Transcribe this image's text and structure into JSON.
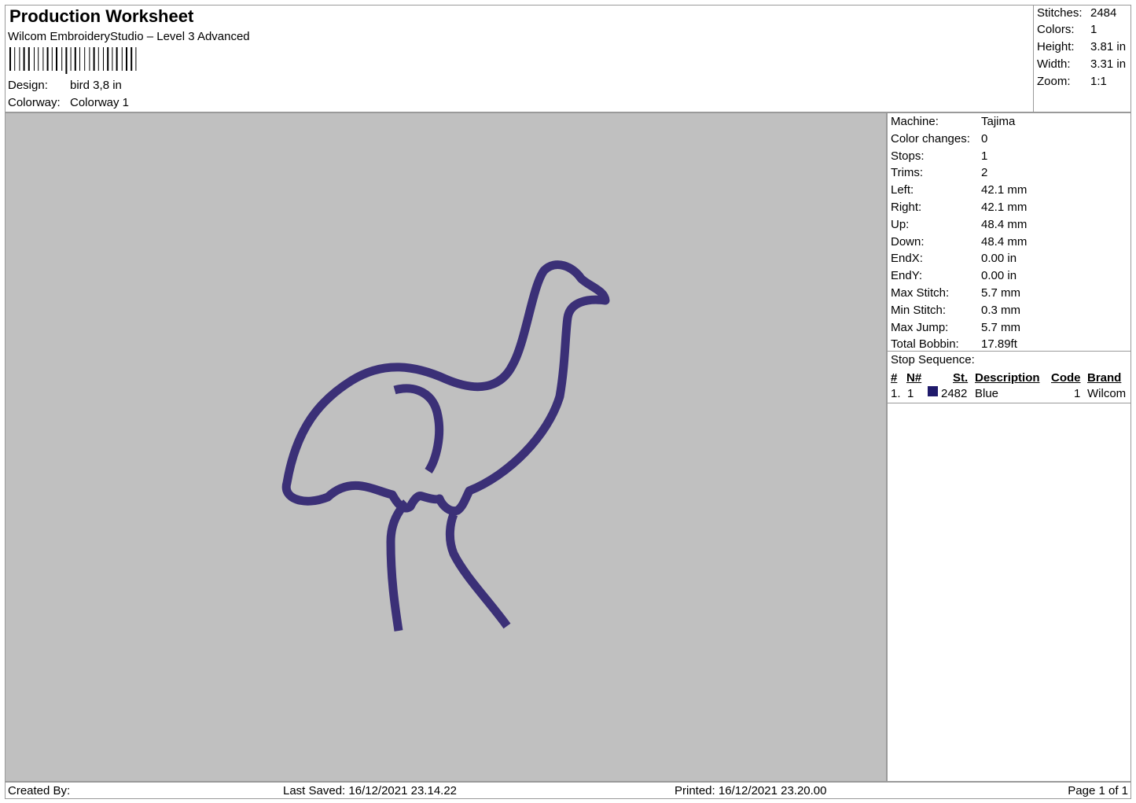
{
  "header": {
    "title": "Production Worksheet",
    "subtitle": "Wilcom EmbroideryStudio – Level 3 Advanced",
    "design_label": "Design:",
    "design_value": "bird 3,8 in",
    "colorway_label": "Colorway:",
    "colorway_value": "Colorway 1"
  },
  "stats": [
    {
      "label": "Stitches:",
      "value": "2484"
    },
    {
      "label": "Colors:",
      "value": "1"
    },
    {
      "label": "Height:",
      "value": "3.81 in"
    },
    {
      "label": "Width:",
      "value": "3.31 in"
    },
    {
      "label": "Zoom:",
      "value": "1:1"
    }
  ],
  "machine_info": [
    {
      "label": "Machine:",
      "value": "Tajima"
    },
    {
      "label": "Color changes:",
      "value": "0"
    },
    {
      "label": "Stops:",
      "value": "1"
    },
    {
      "label": "Trims:",
      "value": "2"
    },
    {
      "label": "Left:",
      "value": "42.1 mm"
    },
    {
      "label": "Right:",
      "value": "42.1 mm"
    },
    {
      "label": "Up:",
      "value": "48.4 mm"
    },
    {
      "label": "Down:",
      "value": "48.4 mm"
    },
    {
      "label": "EndX:",
      "value": "0.00 in"
    },
    {
      "label": "EndY:",
      "value": "0.00 in"
    },
    {
      "label": "Max Stitch:",
      "value": "5.7 mm"
    },
    {
      "label": "Min Stitch:",
      "value": "0.3 mm"
    },
    {
      "label": "Max Jump:",
      "value": "5.7 mm"
    },
    {
      "label": "Total Bobbin:",
      "value": "17.89ft"
    }
  ],
  "stop_sequence": {
    "title": "Stop Sequence:",
    "headers": {
      "num": "#",
      "n": "N#",
      "st": "St.",
      "description": "Description",
      "code": "Code",
      "brand": "Brand"
    },
    "rows": [
      {
        "num": "1.",
        "n": "1",
        "color": "#1f1a6b",
        "st": "2482",
        "description": "Blue",
        "code": "1",
        "brand": "Wilcom"
      }
    ]
  },
  "design_preview": {
    "background": "#c0c0c0",
    "thread_color": "#3b3077",
    "icon": "bird-outline-embroidery"
  },
  "footer": {
    "created_by": "Created By:",
    "last_saved": "Last Saved: 16/12/2021 23.14.22",
    "printed": "Printed: 16/12/2021 23.20.00",
    "page": "Page 1 of 1"
  }
}
